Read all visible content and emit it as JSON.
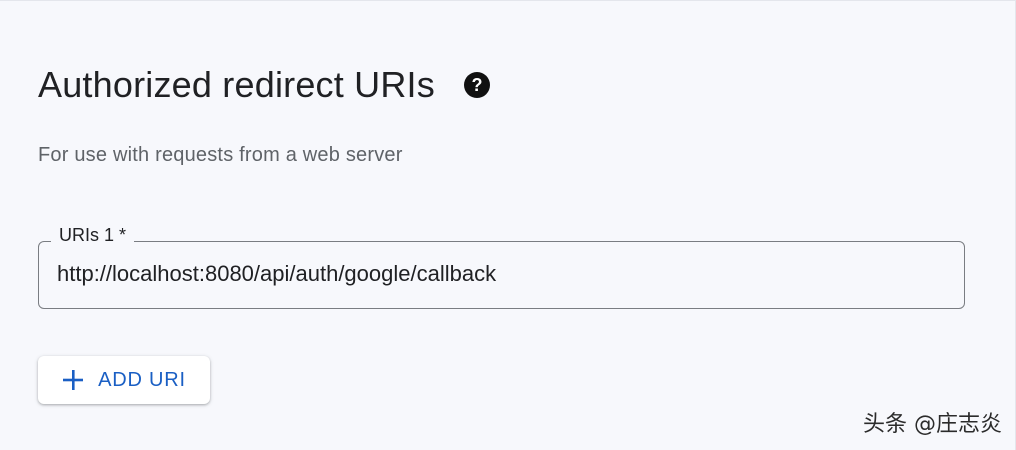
{
  "section": {
    "title": "Authorized redirect URIs",
    "help_icon": "help-circle-icon",
    "subtitle": "For use with requests from a web server"
  },
  "uri_field": {
    "label": "URIs 1 *",
    "value": "http://localhost:8080/api/auth/google/callback"
  },
  "add_button": {
    "icon": "plus-icon",
    "label": "ADD URI"
  },
  "watermark": "头条 @庄志炎",
  "colors": {
    "accent": "#1a5fc4",
    "text": "#202124",
    "muted": "#5f6368",
    "background": "#f7f8fc"
  }
}
